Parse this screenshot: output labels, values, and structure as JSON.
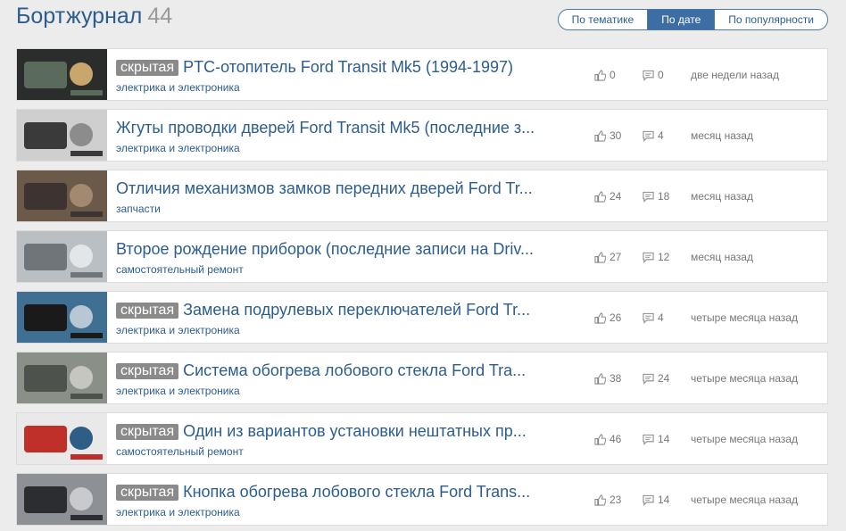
{
  "header": {
    "title": "Бортжурнал",
    "count": "44",
    "sort": [
      {
        "label": "По тематике",
        "active": false
      },
      {
        "label": "По дате",
        "active": true
      },
      {
        "label": "По популярности",
        "active": false
      }
    ]
  },
  "posts": [
    {
      "badge": "скрытая",
      "title": "PTC-отопитель Ford Transit Mk5 (1994-1997)",
      "category": "электрика и электроника",
      "likes": "0",
      "comments": "0",
      "time": "две недели назад",
      "thumb_colors": [
        "#2a2d2c",
        "#5a6b5e",
        "#c9a66b"
      ]
    },
    {
      "badge": "",
      "title": "Жгуты проводки дверей Ford Transit Mk5 (последние з...",
      "category": "электрика и электроника",
      "likes": "30",
      "comments": "4",
      "time": "месяц назад",
      "thumb_colors": [
        "#cfcfcf",
        "#3a3a3a",
        "#8c8c8c"
      ]
    },
    {
      "badge": "",
      "title": "Отличия механизмов замков передних дверей Ford Tr...",
      "category": "запчасти",
      "likes": "24",
      "comments": "18",
      "time": "месяц назад",
      "thumb_colors": [
        "#6b5a4a",
        "#3d3431",
        "#a28a70"
      ]
    },
    {
      "badge": "",
      "title": "Второе рождение приборок (последние записи на Driv...",
      "category": "самостоятельный ремонт",
      "likes": "27",
      "comments": "12",
      "time": "месяц назад",
      "thumb_colors": [
        "#b9bfc2",
        "#6f7579",
        "#e3e6e8"
      ]
    },
    {
      "badge": "скрытая",
      "title": "Замена подрулевых переключателей Ford Tr...",
      "category": "электрика и электроника",
      "likes": "26",
      "comments": "4",
      "time": "четыре месяца назад",
      "thumb_colors": [
        "#3f6f92",
        "#1a1a1a",
        "#b7c7d4"
      ]
    },
    {
      "badge": "скрытая",
      "title": "Система обогрева лобового стекла Ford Tra...",
      "category": "электрика и электроника",
      "likes": "38",
      "comments": "24",
      "time": "четыре месяца назад",
      "thumb_colors": [
        "#8a8f87",
        "#4e524d",
        "#c4c6bf"
      ]
    },
    {
      "badge": "скрытая",
      "title": "Один из вариантов установки нештатных пр...",
      "category": "самостоятельный ремонт",
      "likes": "46",
      "comments": "14",
      "time": "четыре месяца назад",
      "thumb_colors": [
        "#e9e9e9",
        "#c0302a",
        "#2e5d86"
      ]
    },
    {
      "badge": "скрытая",
      "title": "Кнопка обогрева лобового стекла Ford Trans...",
      "category": "электрика и электроника",
      "likes": "23",
      "comments": "14",
      "time": "четыре месяца назад",
      "thumb_colors": [
        "#8d9196",
        "#2b2d30",
        "#c8cacd"
      ]
    }
  ]
}
